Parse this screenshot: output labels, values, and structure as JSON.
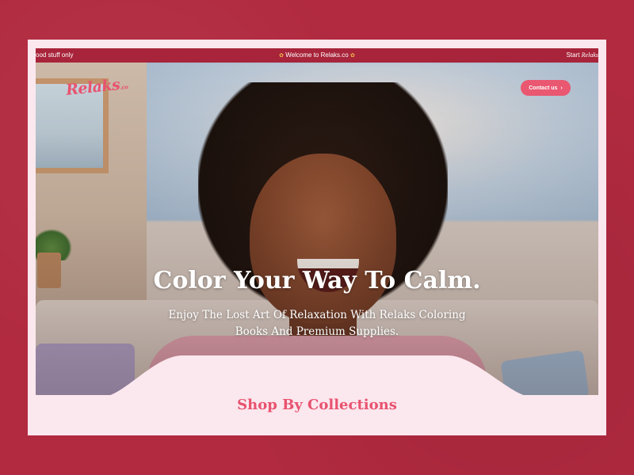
{
  "announcement_bar": {
    "left_text": "ood stuff only",
    "center_text": "Welcome to Relaks.co",
    "right_text_prefix": "Start",
    "right_text_brand": "Relaks"
  },
  "header": {
    "logo_text": "Relaks",
    "logo_suffix": ".co",
    "contact_label": "Contact us",
    "contact_arrow": "›"
  },
  "hero": {
    "headline": "Color Your Way To Calm.",
    "subtext": "Enjoy The Lost Art Of Relaxation With Relaks Coloring Books And Premium Supplies."
  },
  "collections": {
    "title": "Shop By Collections"
  },
  "colors": {
    "background": "#b12a3f",
    "announcement": "#a8243a",
    "accent": "#e8536f",
    "page": "#fbe7ee"
  },
  "icons": {
    "announcement_decor": "flower-icon",
    "contact_chevron": "chevron-right-icon"
  }
}
